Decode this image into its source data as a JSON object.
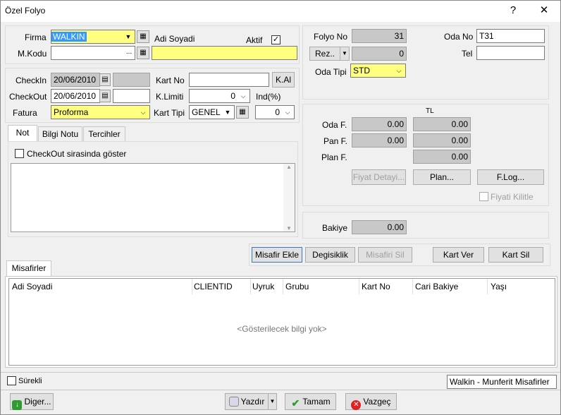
{
  "window": {
    "title": "Özel Folyo",
    "help": "?",
    "close": "✕"
  },
  "top_form": {
    "firma_label": "Firma",
    "firma_value": "WALKIN",
    "adi_soyadi_label": "Adi Soyadi",
    "aktif_label": "Aktif",
    "aktif_checked": "✓",
    "mkodu_label": "M.Kodu",
    "mkodu_value": "",
    "browse": "...",
    "adi_soyadi_value": ""
  },
  "dates_form": {
    "checkin_label": "CheckIn",
    "checkin_value": "20/06/2010",
    "checkout_label": "CheckOut",
    "checkout_value": "20/06/2010",
    "fatura_label": "Fatura",
    "fatura_value": "Proforma",
    "kart_no_label": "Kart No",
    "kart_no_value": "",
    "kal_button": "K.Al",
    "klimiti_label": "K.Limiti",
    "klimiti_value": "0",
    "ind_label": "Ind(%)",
    "kart_tipi_label": "Kart Tipi",
    "kart_tipi_value": "GENEL",
    "ind_value": "0"
  },
  "tabs": [
    {
      "label": "Not"
    },
    {
      "label": "Bilgi Notu"
    },
    {
      "label": "Tercihler"
    }
  ],
  "note": {
    "checkout_show_label": "CheckOut sirasinda göster",
    "text": ""
  },
  "folyo": {
    "folyo_no_label": "Folyo No",
    "folyo_no_value": "31",
    "rez_button": "Rez..",
    "rez_value": "0",
    "oda_no_label": "Oda No",
    "oda_no_value": "T31",
    "tel_label": "Tel",
    "tel_value": "",
    "oda_tipi_label": "Oda Tipi",
    "oda_tipi_value": "STD"
  },
  "amounts": {
    "currency": "TL",
    "oda_label": "Oda F.",
    "oda_value1": "0.00",
    "oda_value2": "0.00",
    "pan_label": "Pan F.",
    "pan_value1": "0.00",
    "pan_value2": "0.00",
    "plan_label": "Plan F.",
    "plan_value2": "0.00",
    "fiyat_detayi_button": "Fiyat Detayi...",
    "plan_button": "Plan...",
    "flog_button": "F.Log...",
    "fiyati_kilitle_label": "Fiyati Kilitle"
  },
  "bakiye": {
    "label": "Bakiye",
    "value": "0.00"
  },
  "guest_actions": {
    "misafir_ekle": "Misafir Ekle",
    "degisiklik": "Degisiklik",
    "misafiri_sil": "Misafiri Sil",
    "kart_ver": "Kart Ver",
    "kart_sil": "Kart Sil"
  },
  "guests": {
    "tab_label": "Misafirler",
    "columns": [
      "Adi Soyadi",
      "CLIENTID",
      "Uyruk",
      "Grubu",
      "Kart No",
      "Cari Bakiye",
      "Yaşı"
    ],
    "empty_text": "<Gösterilecek bilgi yok>"
  },
  "status": {
    "surekli_label": "Sürekli",
    "right_text": "Walkin - Munferit Misafirler"
  },
  "footer": {
    "diger_button": "Diger...",
    "yazdir_button": "Yazdır",
    "tamam_button": "Tamam",
    "vazgec_button": "Vazgeç"
  },
  "colors": {
    "yellow_field": "#ffff80",
    "selection": "#3399ff",
    "gray_field": "#c8c8c8"
  },
  "icons": [
    "dropdown-arrow-icon",
    "lookup-grid-icon",
    "calendar-icon",
    "checkmark-icon",
    "arrow-down-green-icon",
    "printer-icon",
    "tick-green-icon",
    "cancel-red-icon"
  ]
}
